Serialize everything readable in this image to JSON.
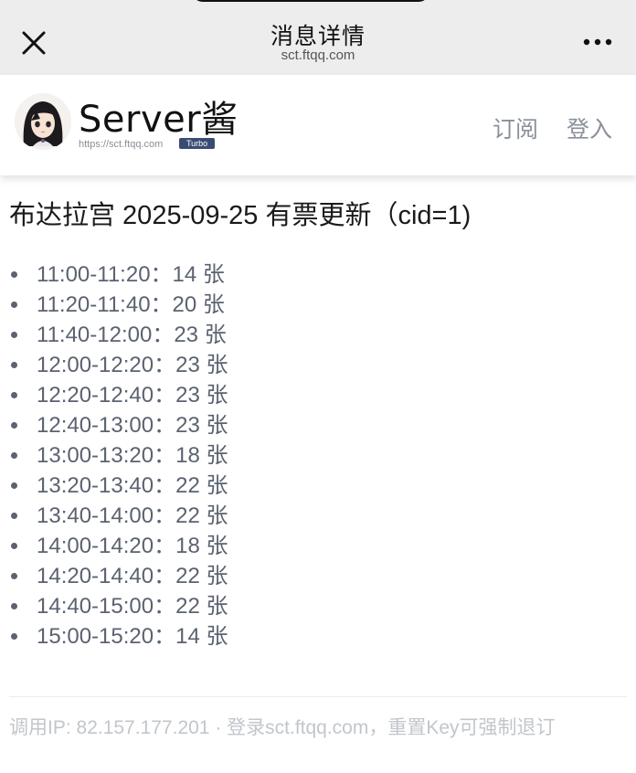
{
  "topbar": {
    "title": "消息详情",
    "subtitle": "sct.ftqq.com"
  },
  "header": {
    "brand": "Server酱",
    "url": "https://sct.ftqq.com",
    "badge": "Turbo",
    "subscribe": "订阅",
    "login": "登入"
  },
  "message": {
    "title": "布达拉宫 2025-09-25 有票更新（cid=1)",
    "slots": [
      "11:00-11:20：14 张",
      "11:20-11:40：20 张",
      "11:40-12:00：23 张",
      "12:00-12:20：23 张",
      "12:20-12:40：23 张",
      "12:40-13:00：23 张",
      "13:00-13:20：18 张",
      "13:20-13:40：22 张",
      "13:40-14:00：22 张",
      "14:00-14:20：18 张",
      "14:20-14:40：22 张",
      "14:40-15:00：22 张",
      "15:00-15:20：14 张"
    ]
  },
  "footer": {
    "text": "调用IP: 82.157.177.201 · 登录sct.ftqq.com，重置Key可强制退订"
  },
  "icons": {
    "close": "close-icon",
    "more": "more-icon",
    "avatar": "avatar"
  },
  "colors": {
    "topbar_bg": "#ededed",
    "badge_bg": "#3a4c74",
    "list_text": "#5b6270",
    "nav_text": "#8a9099",
    "footer_text": "#c2c6cc"
  }
}
